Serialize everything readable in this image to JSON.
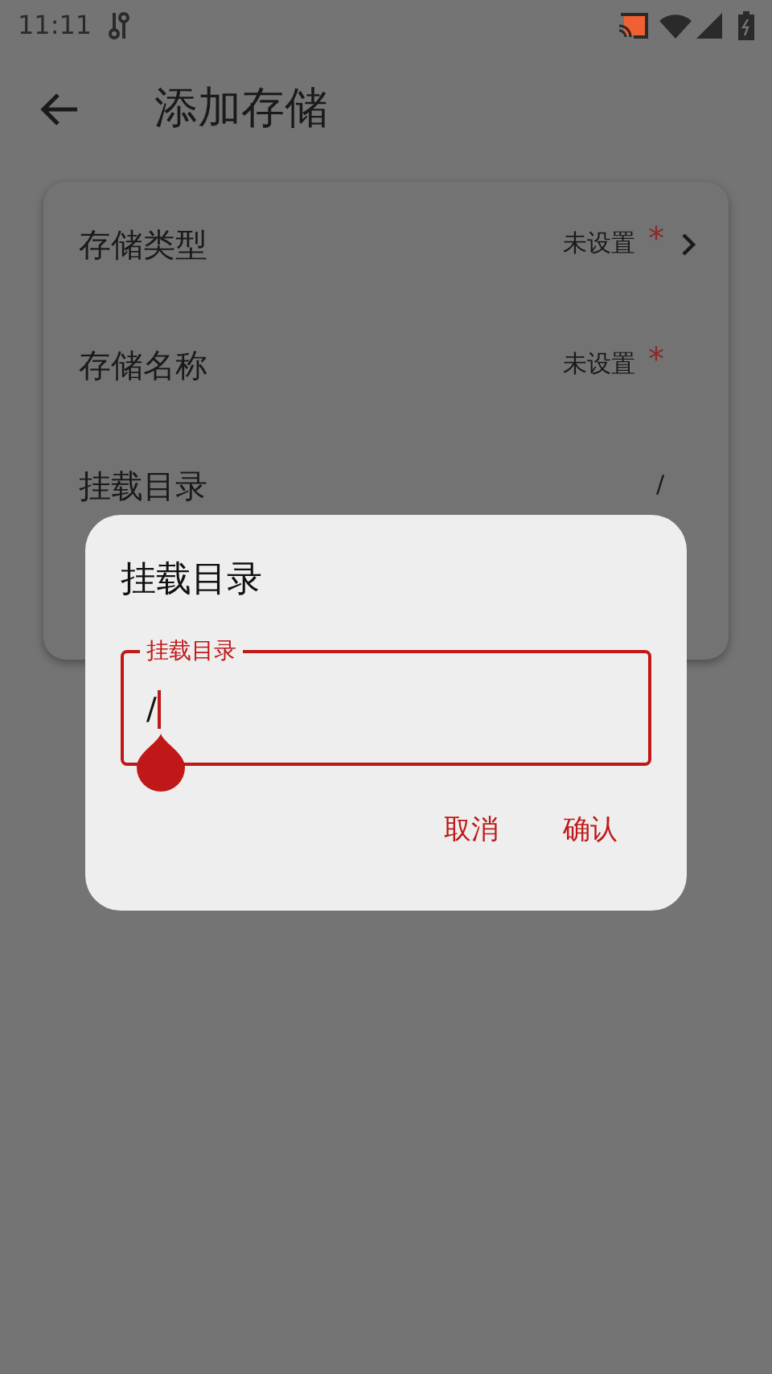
{
  "status_bar": {
    "time": "11:11"
  },
  "header": {
    "title": "添加存储"
  },
  "settings": [
    {
      "label": "存储类型",
      "value": "未设置",
      "mark": "*",
      "chevron": true
    },
    {
      "label": "存储名称",
      "value": "未设置",
      "mark": "*",
      "chevron": false
    },
    {
      "label": "挂载目录",
      "value": "/",
      "chevron": false
    }
  ],
  "dialog": {
    "title": "挂载目录",
    "field": {
      "label": "挂载目录",
      "value": "/",
      "focused": true
    },
    "buttons": [
      "取消",
      "确认"
    ]
  }
}
